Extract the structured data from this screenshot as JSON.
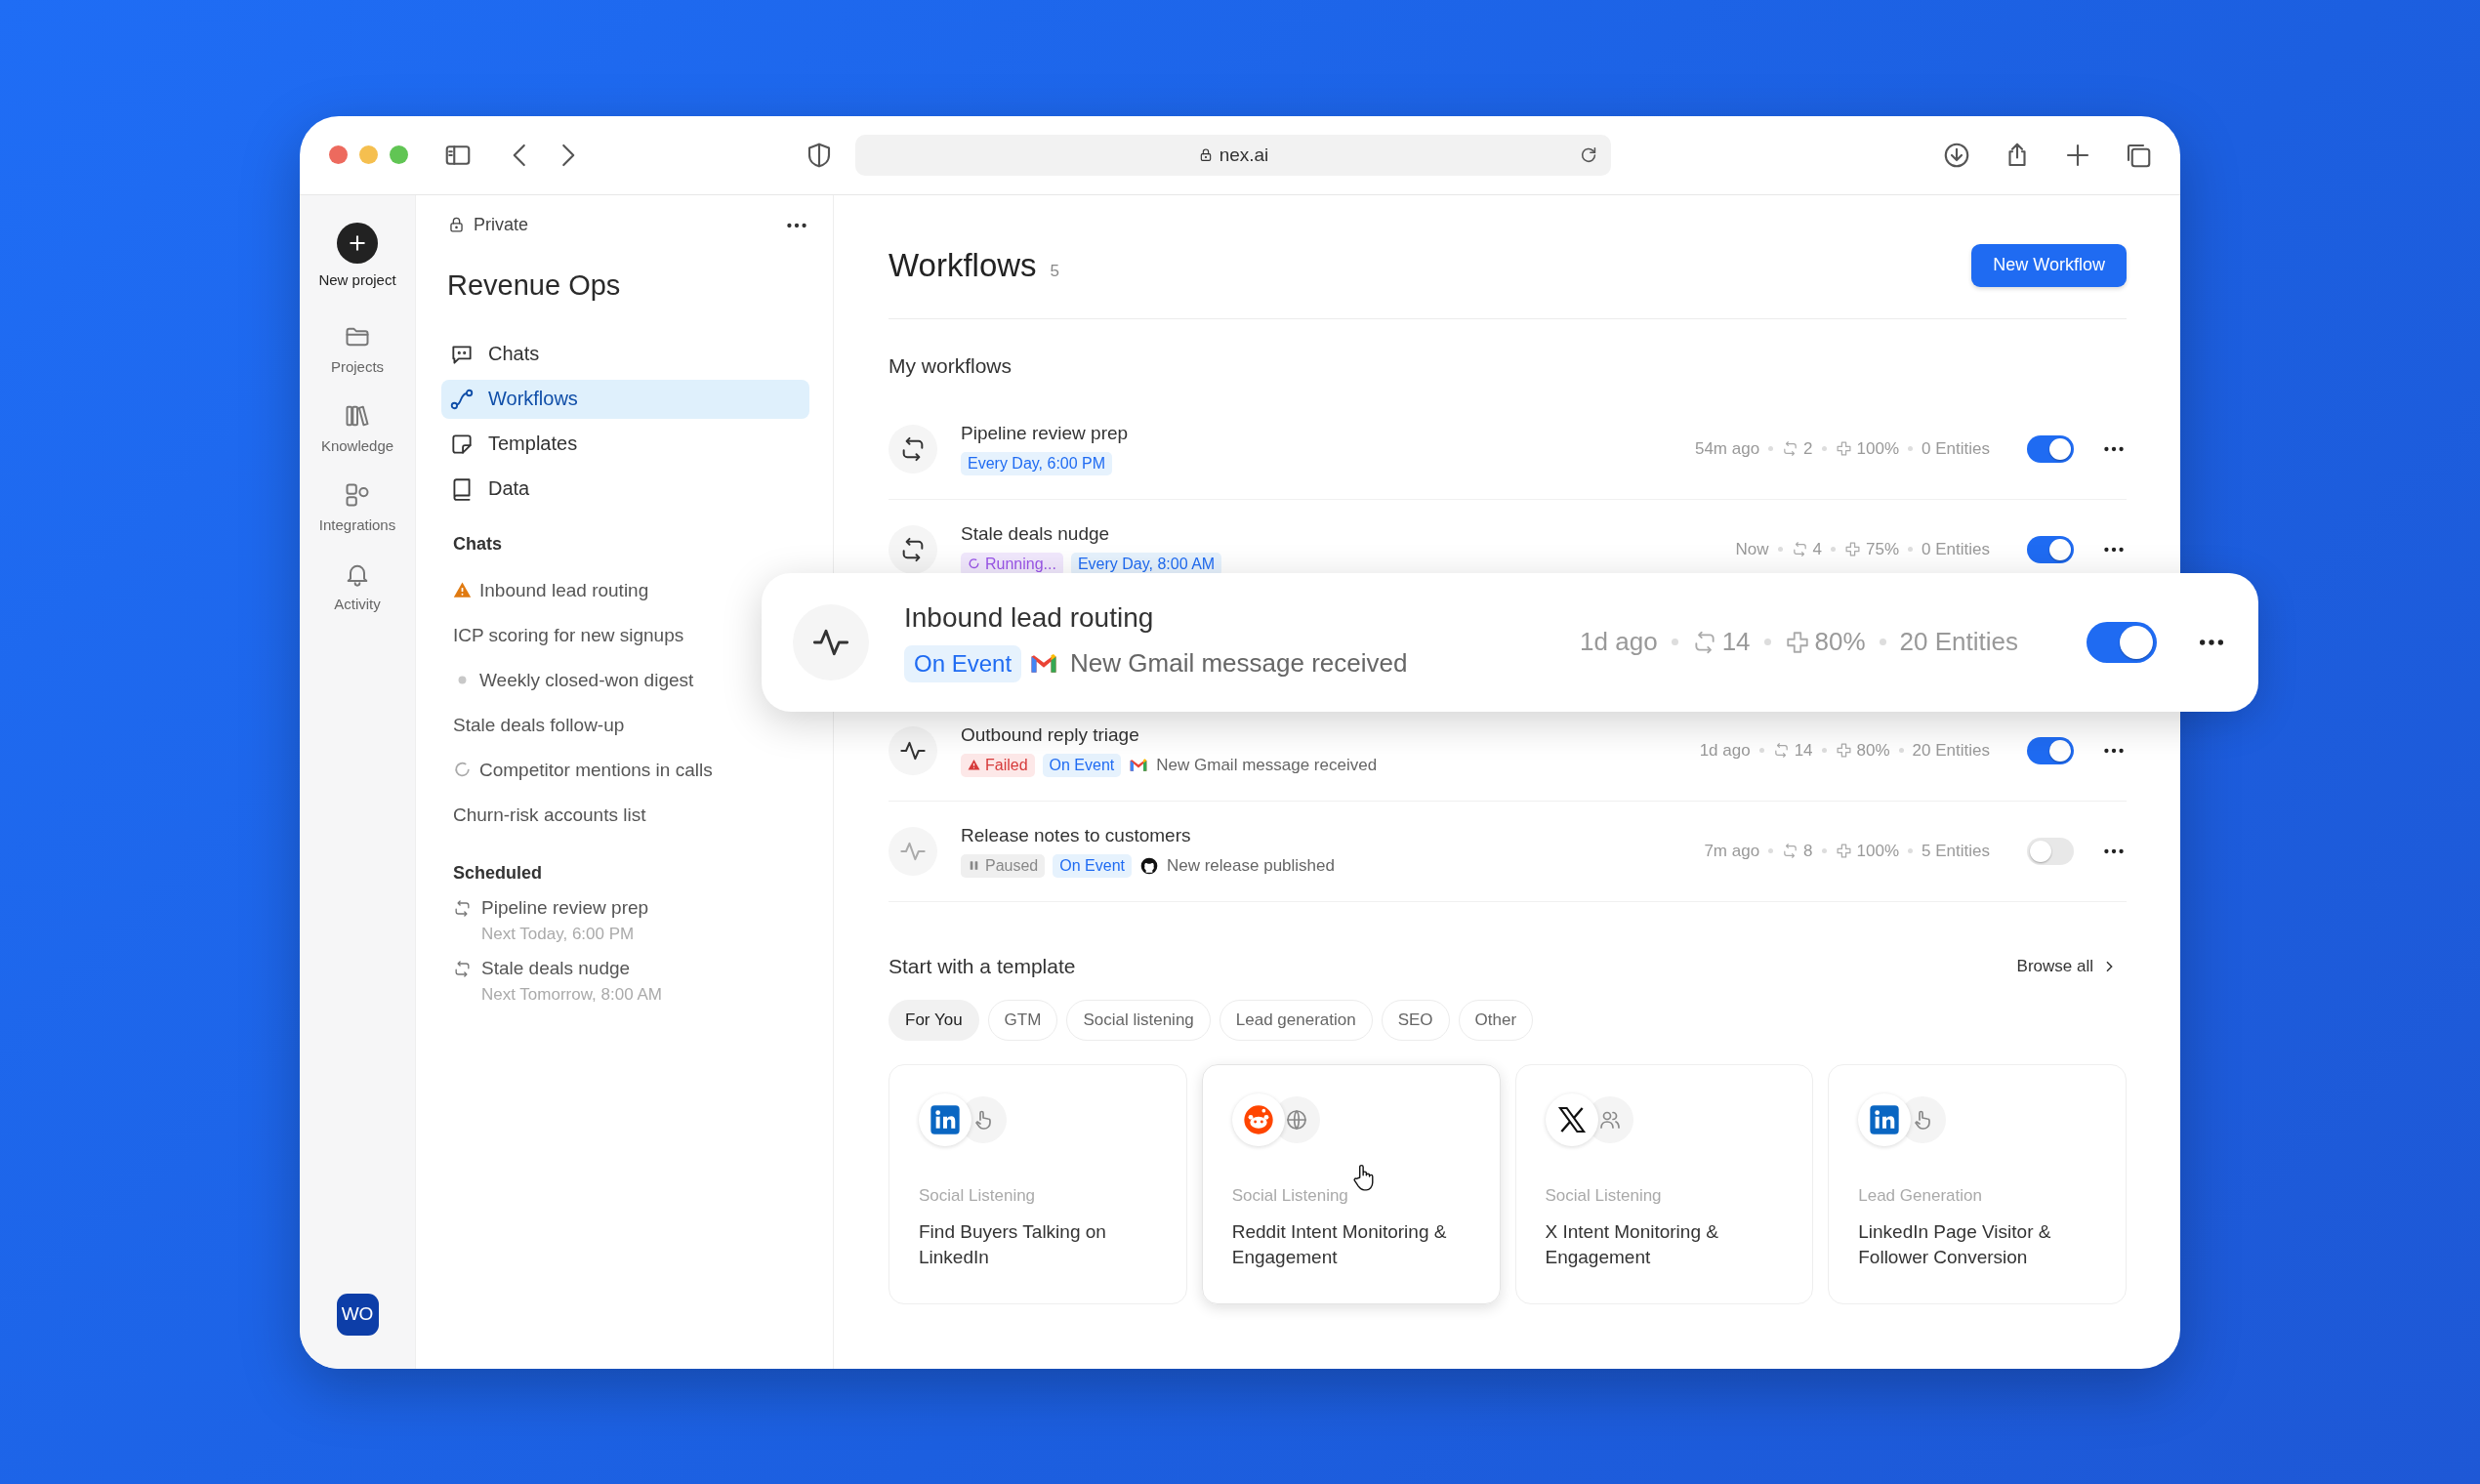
{
  "browser": {
    "url": "nex.ai"
  },
  "rail": {
    "items": [
      {
        "label": "New project",
        "kind": "new"
      },
      {
        "label": "Projects",
        "kind": "folder"
      },
      {
        "label": "Knowledge",
        "kind": "books"
      },
      {
        "label": "Integrations",
        "kind": "blocks"
      },
      {
        "label": "Activity",
        "kind": "bell"
      }
    ],
    "avatar": "WO"
  },
  "sidebar": {
    "visibility": "Private",
    "title": "Revenue Ops",
    "nav": [
      {
        "label": "Chats",
        "selected": false
      },
      {
        "label": "Workflows",
        "selected": true
      },
      {
        "label": "Templates",
        "selected": false
      },
      {
        "label": "Data",
        "selected": false
      }
    ],
    "sections": [
      {
        "heading": "Chats",
        "items": [
          {
            "label": "Inbound lead routing",
            "kind": "warning"
          },
          {
            "label": "ICP scoring for new signups",
            "kind": "plain"
          },
          {
            "label": "Weekly closed-won digest",
            "kind": "dot"
          },
          {
            "label": "Stale deals follow-up",
            "kind": "plain"
          },
          {
            "label": "Competitor mentions in calls",
            "kind": "loading"
          },
          {
            "label": "Churn-risk accounts list",
            "kind": "plain"
          }
        ]
      },
      {
        "heading": "Scheduled",
        "items": [
          {
            "label": "Pipeline review prep",
            "sub": "Next Today, 6:00 PM",
            "kind": "repeat"
          },
          {
            "label": "Stale deals nudge",
            "sub": "Next Tomorrow, 8:00 AM",
            "kind": "repeat"
          }
        ]
      }
    ]
  },
  "main": {
    "title": "Workflows",
    "count": "5",
    "new_button": "New Workflow",
    "section": "My workflows",
    "workflows": [
      {
        "name": "Pipeline review prep",
        "kind": "schedule",
        "tags": [
          {
            "label": "Every Day, 6:00 PM",
            "kind": "schedule"
          }
        ],
        "last_run": "54m ago",
        "runs": "2",
        "success": "100%",
        "entities": "0 Entities",
        "on": true,
        "lifted": false
      },
      {
        "name": "Stale deals nudge",
        "kind": "schedule",
        "tags": [
          {
            "label": "Running...",
            "kind": "running"
          },
          {
            "label": "Every Day, 8:00 AM",
            "kind": "schedule"
          }
        ],
        "last_run": "Now",
        "runs": "4",
        "success": "75%",
        "entities": "0 Entities",
        "on": true,
        "lifted": false
      },
      {
        "name": "Inbound lead routing",
        "kind": "event",
        "tags": [
          {
            "label": "On Event",
            "kind": "event"
          }
        ],
        "source": {
          "label": "New Gmail message received",
          "kind": "gmail"
        },
        "last_run": "1d ago",
        "runs": "14",
        "success": "80%",
        "entities": "20 Entities",
        "on": true,
        "lifted": true
      },
      {
        "name": "Outbound reply triage",
        "kind": "event",
        "tags": [
          {
            "label": "Failed",
            "kind": "failed"
          },
          {
            "label": "On Event",
            "kind": "event"
          }
        ],
        "source": {
          "label": "New Gmail message received",
          "kind": "gmail"
        },
        "last_run": "1d ago",
        "runs": "14",
        "success": "80%",
        "entities": "20 Entities",
        "on": true,
        "lifted": false
      },
      {
        "name": "Release notes to customers",
        "kind": "event",
        "tags": [
          {
            "label": "Paused",
            "kind": "paused"
          },
          {
            "label": "On Event",
            "kind": "event"
          }
        ],
        "source": {
          "label": "New release published",
          "kind": "github"
        },
        "last_run": "7m ago",
        "runs": "8",
        "success": "100%",
        "entities": "5 Entities",
        "on": false,
        "lifted": false
      }
    ]
  },
  "templates": {
    "title": "Start with a template",
    "browse": "Browse all",
    "filters": [
      {
        "label": "For You",
        "selected": true
      },
      {
        "label": "GTM",
        "selected": false
      },
      {
        "label": "Social listening",
        "selected": false
      },
      {
        "label": "Lead generation",
        "selected": false
      },
      {
        "label": "SEO",
        "selected": false
      },
      {
        "label": "Other",
        "selected": false
      }
    ],
    "cards": [
      {
        "category": "Social Listening",
        "title": "Find Buyers Talking on LinkedIn",
        "hovered": false
      },
      {
        "category": "Social Listening",
        "title": "Reddit Intent Monitoring & Engagement",
        "hovered": true
      },
      {
        "category": "Social Listening",
        "title": "X Intent Monitoring & Engagement",
        "hovered": false
      },
      {
        "category": "Lead Generation",
        "title": "LinkedIn Page Visitor & Follower Conversion",
        "hovered": false
      }
    ]
  }
}
